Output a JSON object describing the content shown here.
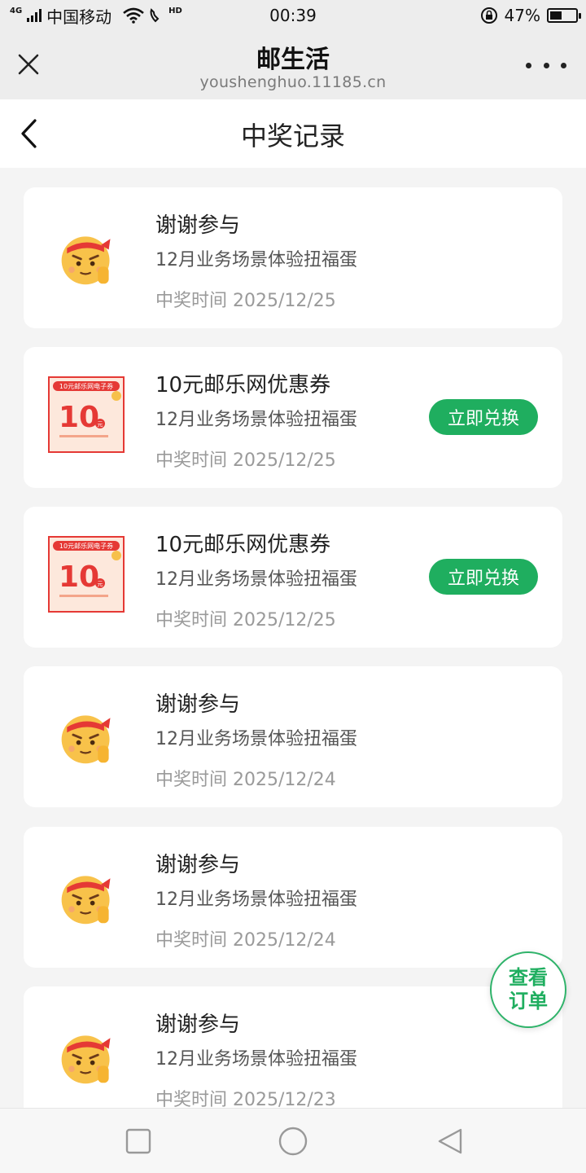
{
  "status_bar": {
    "network_type": "4G",
    "carrier": "中国移动",
    "hd_label": "HD",
    "time": "00:39",
    "battery_percent": "47%",
    "battery_level": 0.47
  },
  "browser": {
    "title": "邮生活",
    "url": "youshenghuo.11185.cn"
  },
  "page": {
    "title": "中奖记录"
  },
  "records": [
    {
      "title": "谢谢参与",
      "subtitle": "12月业务场景体验扭福蛋",
      "time": "中奖时间 2025/12/25",
      "thumb": "mascot-icon",
      "button": null
    },
    {
      "title": "10元邮乐网优惠券",
      "subtitle": "12月业务场景体验扭福蛋",
      "time": "中奖时间 2025/12/25",
      "thumb": "coupon-icon",
      "button": "立即兑换"
    },
    {
      "title": "10元邮乐网优惠券",
      "subtitle": "12月业务场景体验扭福蛋",
      "time": "中奖时间 2025/12/25",
      "thumb": "coupon-icon",
      "button": "立即兑换"
    },
    {
      "title": "谢谢参与",
      "subtitle": "12月业务场景体验扭福蛋",
      "time": "中奖时间 2025/12/24",
      "thumb": "mascot-icon",
      "button": null
    },
    {
      "title": "谢谢参与",
      "subtitle": "12月业务场景体验扭福蛋",
      "time": "中奖时间 2025/12/24",
      "thumb": "mascot-icon",
      "button": null
    },
    {
      "title": "谢谢参与",
      "subtitle": "12月业务场景体验扭福蛋",
      "time": "中奖时间 2025/12/23",
      "thumb": "mascot-icon",
      "button": null
    }
  ],
  "coupon_art": {
    "header": "10元邮乐网电子券",
    "amount": "10",
    "unit": "元"
  },
  "float_button": {
    "line1": "查看",
    "line2": "订单"
  },
  "colors": {
    "accent_green": "#1fae5f",
    "background": "#f4f4f4",
    "coupon_red": "#e53935"
  }
}
